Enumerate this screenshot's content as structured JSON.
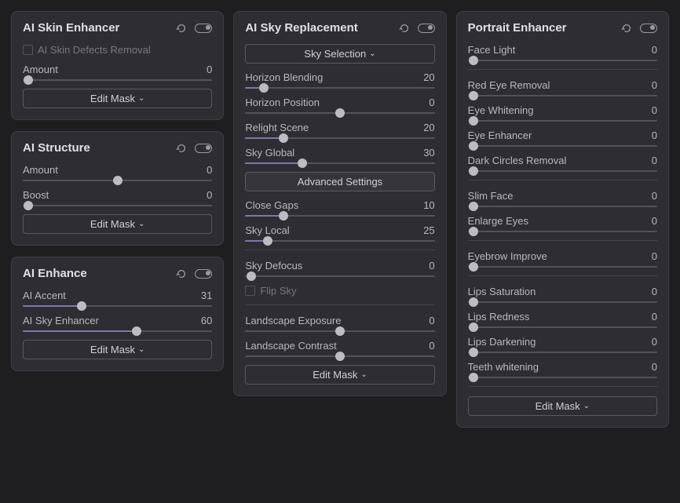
{
  "common": {
    "edit_mask": "Edit Mask"
  },
  "skin": {
    "title": "AI Skin Enhancer",
    "defects_label": "AI Skin Defects Removal",
    "amount_label": "Amount",
    "amount_value": "0"
  },
  "structure": {
    "title": "AI Structure",
    "amount_label": "Amount",
    "amount_value": "0",
    "boost_label": "Boost",
    "boost_value": "0"
  },
  "enhance": {
    "title": "AI Enhance",
    "accent_label": "AI Accent",
    "accent_value": "31",
    "sky_label": "AI Sky Enhancer",
    "sky_value": "60"
  },
  "sky": {
    "title": "AI Sky Replacement",
    "selection_btn": "Sky Selection",
    "horizon_blend_label": "Horizon Blending",
    "horizon_blend_value": "20",
    "horizon_pos_label": "Horizon Position",
    "horizon_pos_value": "0",
    "relight_label": "Relight Scene",
    "relight_value": "20",
    "global_label": "Sky Global",
    "global_value": "30",
    "advanced_btn": "Advanced Settings",
    "close_gaps_label": "Close Gaps",
    "close_gaps_value": "10",
    "local_label": "Sky Local",
    "local_value": "25",
    "defocus_label": "Sky Defocus",
    "defocus_value": "0",
    "flip_label": "Flip Sky",
    "exposure_label": "Landscape Exposure",
    "exposure_value": "0",
    "contrast_label": "Landscape Contrast",
    "contrast_value": "0"
  },
  "portrait": {
    "title": "Portrait Enhancer",
    "face_light_label": "Face Light",
    "face_light_value": "0",
    "red_eye_label": "Red Eye Removal",
    "red_eye_value": "0",
    "eye_white_label": "Eye Whitening",
    "eye_white_value": "0",
    "eye_enh_label": "Eye Enhancer",
    "eye_enh_value": "0",
    "dark_circles_label": "Dark Circles Removal",
    "dark_circles_value": "0",
    "slim_label": "Slim Face",
    "slim_value": "0",
    "enlarge_label": "Enlarge Eyes",
    "enlarge_value": "0",
    "eyebrow_label": "Eyebrow Improve",
    "eyebrow_value": "0",
    "lips_sat_label": "Lips Saturation",
    "lips_sat_value": "0",
    "lips_red_label": "Lips Redness",
    "lips_red_value": "0",
    "lips_dark_label": "Lips Darkening",
    "lips_dark_value": "0",
    "teeth_label": "Teeth whitening",
    "teeth_value": "0"
  }
}
